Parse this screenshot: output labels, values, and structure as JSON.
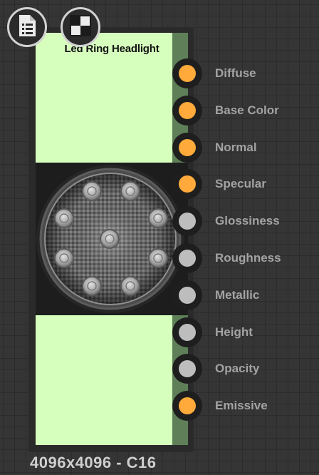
{
  "node": {
    "title": "Led Ring Headlight",
    "resolution": "4096x4096 - C16"
  },
  "toolbar": {
    "doc_button_icon": "document-list-icon",
    "checker_button_icon": "checkerboard-icon"
  },
  "ports": [
    {
      "label": "Diffuse",
      "connected": true,
      "color": "#ffaa3b"
    },
    {
      "label": "Base Color",
      "connected": true,
      "color": "#ffaa3b"
    },
    {
      "label": "Normal",
      "connected": true,
      "color": "#ffaa3b"
    },
    {
      "label": "Specular",
      "connected": true,
      "color": "#ffaa3b"
    },
    {
      "label": "Glossiness",
      "connected": false,
      "color": "#bdbdbd"
    },
    {
      "label": "Roughness",
      "connected": false,
      "color": "#bdbdbd"
    },
    {
      "label": "Metallic",
      "connected": false,
      "color": "#bdbdbd"
    },
    {
      "label": "Height",
      "connected": false,
      "color": "#bdbdbd"
    },
    {
      "label": "Opacity",
      "connected": false,
      "color": "#bdbdbd"
    },
    {
      "label": "Emissive",
      "connected": true,
      "color": "#ffaa3b"
    }
  ]
}
